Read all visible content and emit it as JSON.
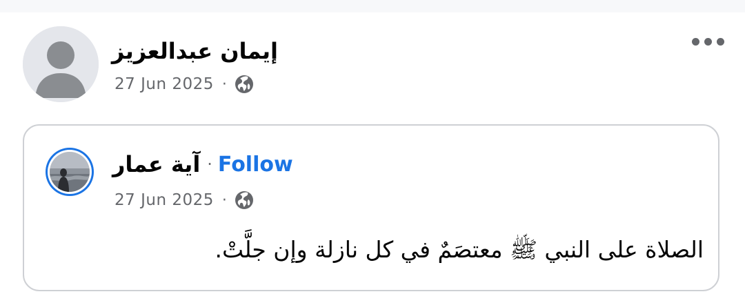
{
  "post": {
    "author_name": "إيمان عبدالعزيز",
    "date": "27 Jun 2025",
    "separator": "·",
    "audience_icon": "globe-icon",
    "more_icon": "more-options-icon"
  },
  "shared_post": {
    "author_name": "آية عمار",
    "separator": "·",
    "follow_label": "Follow",
    "date": "27 Jun 2025",
    "audience_icon": "globe-icon",
    "body_text": "الصلاة على النبي ﷺ معتصَمٌ في كل نازلة وإن جلَّتْ."
  },
  "colors": {
    "accent": "#1b74e4",
    "meta_text": "#65676b",
    "card_border": "#ced0d4",
    "text": "#050505"
  }
}
